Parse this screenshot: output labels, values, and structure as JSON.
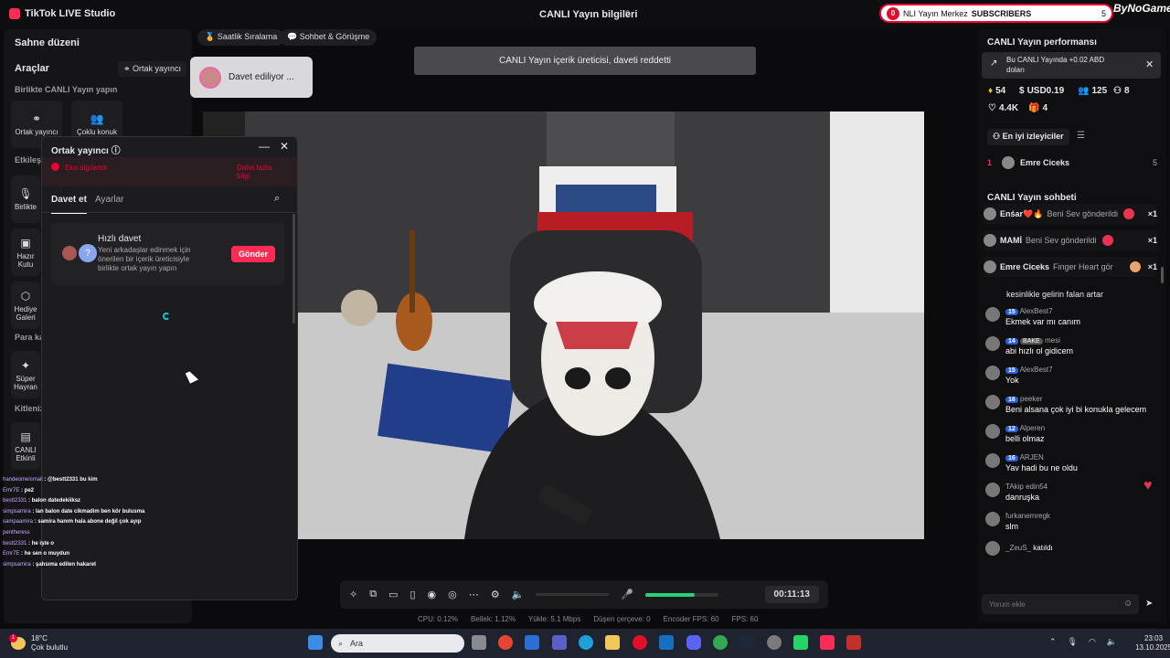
{
  "app": {
    "title": "TikTok LIVE Studio",
    "live_info": "CANLI Yayın bilgileri",
    "brand": "ByNoGame"
  },
  "subscribers": {
    "count_badge": "0",
    "text": "NLI Yayın Merkez",
    "label": "SUBSCRIBERS",
    "count": "5"
  },
  "left_panel": {
    "scene_title": "Sahne düzeni",
    "tools_title": "Araçlar",
    "ortak_chip": "Ortak yayıncı",
    "section_together": "Birlikte CANLI Yayın yapın",
    "tools": [
      {
        "label": "Ortak yayıncı"
      },
      {
        "label": "Çoklu konuk"
      }
    ],
    "sections": [
      "Etkileşim",
      "Para ka",
      "Kitleniz"
    ],
    "side_labels": [
      "Birlikte",
      "Hazır Kutu",
      "Hediye Galeri",
      "Süper Hayran",
      "CANLI Etkinli"
    ]
  },
  "pills": [
    "Saatlik Sıralama",
    "Sohbet & Görüşme"
  ],
  "davet_toast": "Davet ediliyor ...",
  "reject_banner": "CANLI Yayın içerik üreticisi, daveti reddetti",
  "dialog": {
    "title": "Ortak yayıncı",
    "echo_text": "Eko algılandı",
    "echo_more": "Daha fazla bilgi",
    "tab_invite": "Davet et",
    "tab_settings": "Ayarlar",
    "quick_title": "Hızlı davet",
    "quick_desc": "Yeni arkadaşlar edinmek için önerilen bir içerik üreticisiyle birlikte ortak yayın yapın",
    "send_label": "Gönder"
  },
  "overlay_chat": [
    {
      "user": "handeomeismail",
      "text": ": @bestt2331 bu kim"
    },
    {
      "user": "Emr7E",
      "text": ": pe2"
    },
    {
      "user": "bestt2331",
      "text": ": balon datedekiiksz"
    },
    {
      "user": "simpsamira",
      "text": ": lan balon date cikmadim ben kör bulusma"
    },
    {
      "user": "sampaamira",
      "text": ": samira hanım hala abone değil çok ayıp"
    },
    {
      "user": "pentheress",
      "text": ""
    },
    {
      "user": "bestt2331",
      "text": ": he işte o"
    },
    {
      "user": "Emr7E",
      "text": ": he sen o muydun"
    },
    {
      "user": "simpsamira",
      "text": ": şahsıma edilen hakaret"
    }
  ],
  "controls": {
    "timer": "00:11:13",
    "mic_level": 0.68
  },
  "stats": [
    "CPU:  0.12%",
    "Bellek:  1.12%",
    "Yükle:  5.1 Mbps",
    "Düşen çerçeve:  0",
    "Encoder FPS:  60",
    "FPS:  60"
  ],
  "right_panel": {
    "perf_title": "CANLI Yayın performansı",
    "perf_toast": "Bu CANLI Yayında +0.02 ABD doları",
    "stats": {
      "diamonds": "54",
      "usd": "USD0.19",
      "viewers": "125",
      "new": "8",
      "likes": "4.4K",
      "gifts": "4"
    },
    "best_viewers": "En iyi izleyiciler",
    "ranking": [
      {
        "rank": "1",
        "name": "Emre Ciceks",
        "score": "5"
      }
    ],
    "chat_title": "CANLI Yayın sohbeti",
    "gift_rows": [
      {
        "name": "Enśar❤️🔥",
        "gift": "Beni Sev gönderildi",
        "count": "×1"
      },
      {
        "name": "MAMİ",
        "gift": "Beni Sev gönderildi",
        "count": "×1"
      },
      {
        "name": "Emre Ciceks",
        "gift": "Finger Heart gör",
        "count": "×1"
      }
    ],
    "partial_message": "kesinlikle gelirin falan artar",
    "messages": [
      {
        "level": "15",
        "user": "AlexBest7",
        "text": "Ekmek var mı canım",
        "bake": ""
      },
      {
        "level": "14",
        "user": "mesi",
        "text": "abi hızlı ol gidicem",
        "bake": "BAKE"
      },
      {
        "level": "15",
        "user": "AlexBest7",
        "text": "Yok",
        "bake": ""
      },
      {
        "level": "16",
        "user": "peeker",
        "text": "Beni alsana çok iyi bi konukla gelecem",
        "bake": ""
      },
      {
        "level": "12",
        "user": "Alperen",
        "text": "belli olmaz",
        "bake": ""
      },
      {
        "level": "16",
        "user": "ARJEN",
        "text": "Yav hadi bu ne oldu",
        "bake": ""
      },
      {
        "level": "",
        "user": "TAkip edin54",
        "text": "danruşka",
        "bake": ""
      },
      {
        "level": "",
        "user": "furkanemregk",
        "text": "slm",
        "bake": ""
      }
    ],
    "joined": {
      "user": "_ZeuS_",
      "text": "katıldı"
    },
    "comment_placeholder": "Yorum ekle"
  },
  "taskbar": {
    "temp": "18°C",
    "weather": "Çok bulutlu",
    "weather_badge": "1",
    "search_placeholder": "Ara",
    "time": "23:03",
    "date": "13.10.2025"
  }
}
